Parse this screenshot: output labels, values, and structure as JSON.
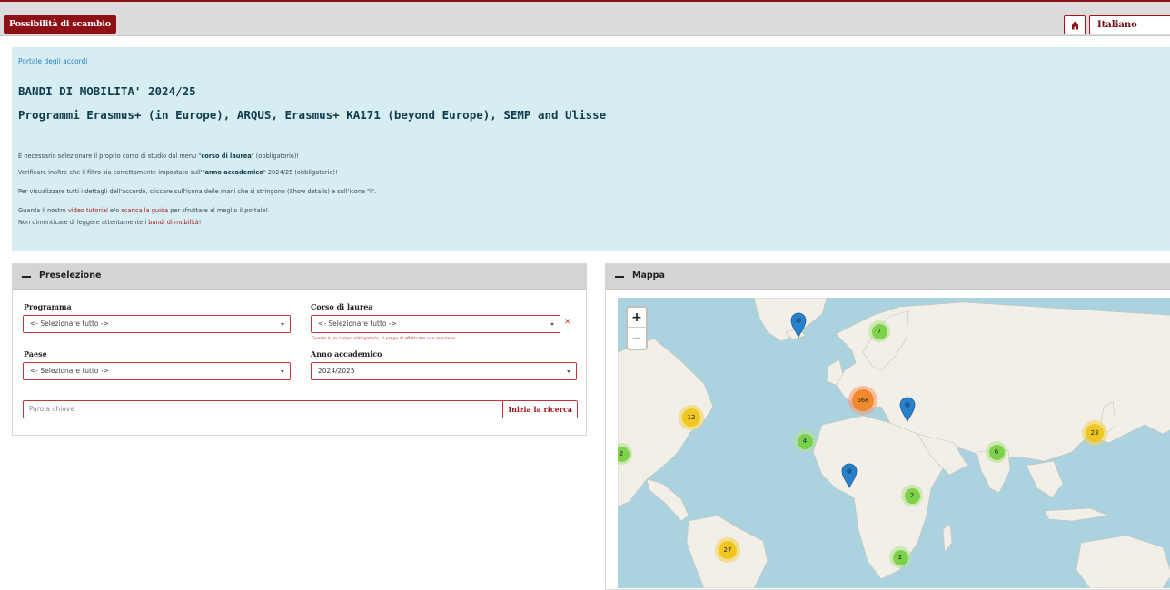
{
  "topbar": {
    "exchange_button": "Possibilità di scambio",
    "language": "Italiano"
  },
  "info": {
    "breadcrumb": "Portale degli accordi",
    "title": "BANDI DI MOBILITA' 2024/25",
    "subtitle": "Programmi Erasmus+ (in Europe), ARQUS, Erasmus+ KA171 (beyond Europe), SEMP and Ulisse",
    "line1_a": "È necessario selezionare il proprio corso di studio dal menu \"",
    "line1_b": "corso di laurea",
    "line1_c": "\" (obbligatorio)!",
    "line2_a": "Verificare inoltre che il filtro sia correttamente impostato sull'\"",
    "line2_b": "anno accademico",
    "line2_c": "\" 2024/25 (obbligatorio)!",
    "line3": "Per visualizzare tutti i dettagli dell'accordo, cliccare sull'icona delle mani che si stringono (Show details) e sull'icona \"i\".",
    "line4_a": "Guarda il nostro ",
    "line4_link1": "video tutorial",
    "line4_b": " e/o ",
    "line4_link2": "scarica la guida",
    "line4_c": " per sfruttare al meglio il portale!",
    "line5_a": "Non dimenticare di leggere attentamente i ",
    "line5_link": "bandi di mobilità",
    "line5_b": "!"
  },
  "preselection": {
    "header": "Preselezione",
    "program_label": "Programma",
    "program_value": "<- Selezionare tutto ->",
    "course_label": "Corso di laurea",
    "course_value": "<- Selezionare tutto ->",
    "course_note": "Questo è un campo obbligatorio, si prega di effettuare una selezione",
    "country_label": "Paese",
    "country_value": "<- Selezionare tutto ->",
    "year_label": "Anno accademico",
    "year_value": "2024/2025",
    "keyword_placeholder": "Parola chiave",
    "search_button": "Inizia la ricerca"
  },
  "map": {
    "header": "Mappa",
    "zoom_in": "+",
    "zoom_out": "−",
    "clusters": [
      "7",
      "568",
      "12",
      "23",
      "4",
      "6",
      "2",
      "2",
      "27",
      "2"
    ]
  },
  "colors": {
    "brand_red": "#8e1015",
    "info_bg": "#d6eef2",
    "cluster_green": "#6ecc39",
    "cluster_yellow": "#f0c20c",
    "cluster_orange": "#f18017",
    "marker_blue": "#2a81cb"
  }
}
